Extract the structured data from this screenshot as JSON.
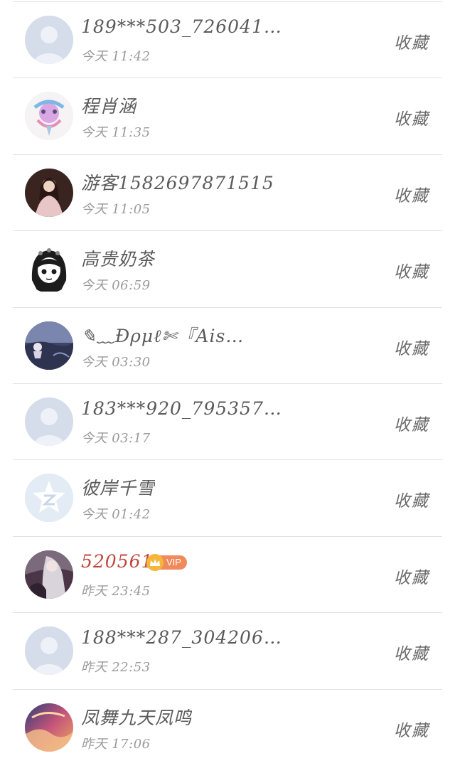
{
  "list": {
    "items": [
      {
        "name": "189***503_726041…",
        "time": "今天 11:42",
        "action": "收藏",
        "avatar": "default-avatar"
      },
      {
        "name": "程肖涵",
        "time": "今天 11:35",
        "action": "收藏",
        "avatar": "anime-avatar"
      },
      {
        "name": "游客1582697871515",
        "time": "今天 11:05",
        "action": "收藏",
        "avatar": "photo-avatar"
      },
      {
        "name": "高贵奶茶",
        "time": "今天 06:59",
        "action": "收藏",
        "avatar": "manga-avatar"
      },
      {
        "name": "✎﹏Ɖρμℓ✄『Ais…",
        "time": "今天 03:30",
        "action": "收藏",
        "avatar": "scenery-avatar"
      },
      {
        "name": "183***920_795357…",
        "time": "今天 03:17",
        "action": "收藏",
        "avatar": "default-avatar"
      },
      {
        "name": "彼岸千雪",
        "time": "今天 01:42",
        "action": "收藏",
        "avatar": "star-avatar"
      },
      {
        "name": "520561",
        "time": "昨天 23:45",
        "action": "收藏",
        "avatar": "illustration-avatar",
        "vip": "VIP"
      },
      {
        "name": "188***287_304206…",
        "time": "昨天 22:53",
        "action": "收藏",
        "avatar": "default-avatar"
      },
      {
        "name": "凤舞九天凤鸣",
        "time": "昨天 17:06",
        "action": "收藏",
        "avatar": "painting-avatar"
      }
    ]
  },
  "colors": {
    "name": "#5a5a5a",
    "vip_name": "#c0463a",
    "time": "#9a9a9a",
    "divider": "#e2e2e2",
    "vip_badge": "#f08a5a",
    "vip_crown": "#f5b73b"
  }
}
